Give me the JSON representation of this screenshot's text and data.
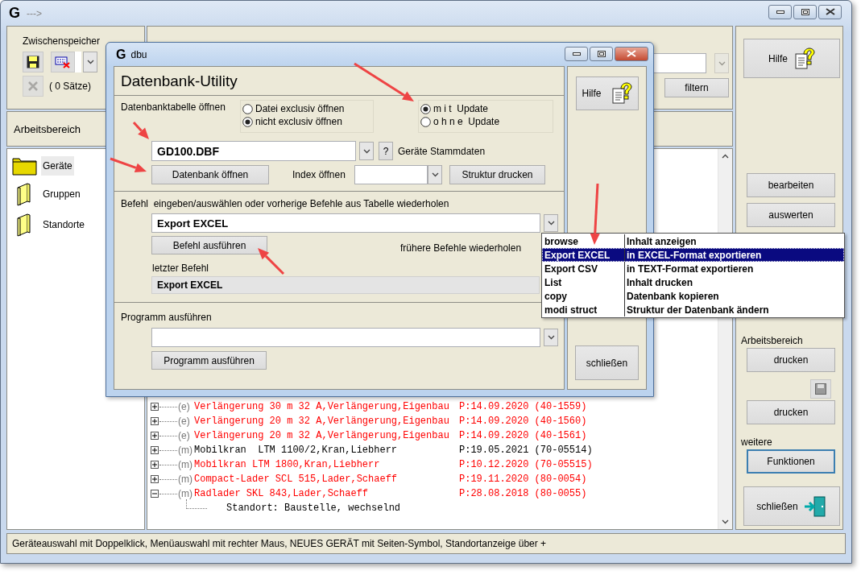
{
  "window": {
    "logo": "G",
    "title": "--->"
  },
  "clipboard": {
    "title": "Zwischenspeicher",
    "count": "( 0 Sätze)"
  },
  "workarea": {
    "title": "Arbeitsbereich"
  },
  "categories": [
    {
      "label": "Geräte",
      "selected": true
    },
    {
      "label": "Gruppen",
      "selected": false
    },
    {
      "label": "Standorte",
      "selected": false
    }
  ],
  "filter": {
    "button": "filtern"
  },
  "tree": [
    {
      "marker": "(e)",
      "name": "Verlängerung 30 m 32 A,Verlängerung,Eigenbau",
      "date": "P:14.09.2020",
      "code": "(40-1559)",
      "color": "#ff0000",
      "expanded": false
    },
    {
      "marker": "(e)",
      "name": "Verlängerung 20 m 32 A,Verlängerung,Eigenbau",
      "date": "P:14.09.2020",
      "code": "(40-1560)",
      "color": "#ff0000",
      "expanded": false
    },
    {
      "marker": "(e)",
      "name": "Verlängerung 20 m 32 A,Verlängerung,Eigenbau",
      "date": "P:14.09.2020",
      "code": "(40-1561)",
      "color": "#ff0000",
      "expanded": false
    },
    {
      "marker": "(m)",
      "name": "Mobilkran  LTM 1100/2,Kran,Liebherr",
      "date": "P:19.05.2021",
      "code": "(70-05514)",
      "color": "#000000",
      "expanded": false
    },
    {
      "marker": "(m)",
      "name": "Mobilkran LTM 1800,Kran,Liebherr",
      "date": "P:10.12.2020",
      "code": "(70-05515)",
      "color": "#ff0000",
      "expanded": false
    },
    {
      "marker": "(m)",
      "name": "Compact-Lader SCL 515,Lader,Schaeff",
      "date": "P:19.11.2020",
      "code": "(80-0054)",
      "color": "#ff0000",
      "expanded": false
    },
    {
      "marker": "(m)",
      "name": "Radlader SKL 843,Lader,Schaeff",
      "date": "P:28.08.2018",
      "code": "(80-0055)",
      "color": "#ff0000",
      "expanded": true,
      "children": [
        {
          "text": "Standort: Baustelle, wechselnd"
        }
      ]
    }
  ],
  "side": {
    "help": "Hilfe",
    "actions": [
      "bearbeiten",
      "auswerten"
    ],
    "print_title": "Arbeitsbereich",
    "print_buttons": [
      "drucken",
      "drucken"
    ],
    "more_title": "weitere",
    "more_button": "Funktionen",
    "close": "schließen"
  },
  "status_bar": "Geräteauswahl mit Doppelklick, Menüauswahl mit rechter Maus, NEUES GERÄT mit Seiten-Symbol, Standortanzeige über +",
  "dialog": {
    "logo": "G",
    "title": "dbu",
    "heading": "Datenbank-Utility",
    "help": "Hilfe",
    "close": "schließen",
    "open_section": {
      "label": "Datenbanktabelle öffnen",
      "access": [
        {
          "label": "Datei exclusiv öffnen",
          "selected": false
        },
        {
          "label": "nicht exclusiv öffnen",
          "selected": true
        }
      ],
      "update": [
        {
          "label": "m i t  Update",
          "selected": true
        },
        {
          "label": "o h n e  Update",
          "selected": false
        }
      ],
      "table": "GD100.DBF",
      "help_button": "?",
      "description": "Geräte Stammdaten",
      "open_button": "Datenbank öffnen",
      "index_label": "Index öffnen",
      "structure_button": "Struktur drucken"
    },
    "command_section": {
      "label": "Befehl  eingeben/auswählen oder vorherige Befehle aus Tabelle wiederholen",
      "command": "Export EXCEL",
      "run_button": "Befehl ausführen",
      "history_label": "frühere Befehle wiederholen",
      "last_label": "letzter Befehl",
      "last": "Export EXCEL"
    },
    "program_section": {
      "label": "Programm ausführen",
      "run_button": "Programm ausführen"
    }
  },
  "command_list": [
    {
      "command": "browse",
      "description": "Inhalt anzeigen",
      "selected": false
    },
    {
      "command": "Export EXCEL",
      "description": "in EXCEL-Format exportieren",
      "selected": true
    },
    {
      "command": "Export CSV",
      "description": "in TEXT-Format exportieren",
      "selected": false
    },
    {
      "command": "List",
      "description": "Inhalt drucken",
      "selected": false
    },
    {
      "command": "copy",
      "description": "Datenbank kopieren",
      "selected": false
    },
    {
      "command": "modi struct",
      "description": "Struktur der Datenbank ändern",
      "selected": false
    }
  ]
}
